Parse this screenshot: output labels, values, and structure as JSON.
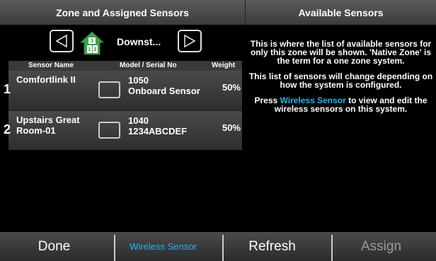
{
  "header": {
    "left_title": "Zone and Assigned Sensors",
    "right_title": "Available Sensors"
  },
  "zone_nav": {
    "zone_name": "Downst...",
    "house_icon": "house-zones-icon",
    "prev_icon": "triangle-left-icon",
    "next_icon": "triangle-right-icon"
  },
  "table": {
    "columns": [
      "Sensor Name",
      "Model / Serial No",
      "Weight"
    ],
    "rows": [
      {
        "index": "1",
        "name": "Comfortlink II",
        "model": "1050",
        "serial": "Onboard Sensor",
        "weight": "50%"
      },
      {
        "index": "2",
        "name": "Upstairs Great Room-01",
        "model": "1040",
        "serial": "1234ABCDEF",
        "weight": "50%"
      }
    ]
  },
  "info": {
    "p1": "This is where the list of available sensors for only this zone will be shown. 'Native Zone' is the term for a one zone system.",
    "p2": "This list of sensors will change depending on how the system is configured.",
    "p3_pre": "Press ",
    "p3_link": "Wireless Sensor",
    "p3_post": " to view and edit the wireless sensors on this system."
  },
  "footer": {
    "done": "Done",
    "wireless": "Wireless Sensor",
    "refresh": "Refresh",
    "assign": "Assign"
  },
  "colors": {
    "accent": "#2ab4ea",
    "disabled": "#9a9a9a",
    "house_green": "#3fa34d"
  }
}
